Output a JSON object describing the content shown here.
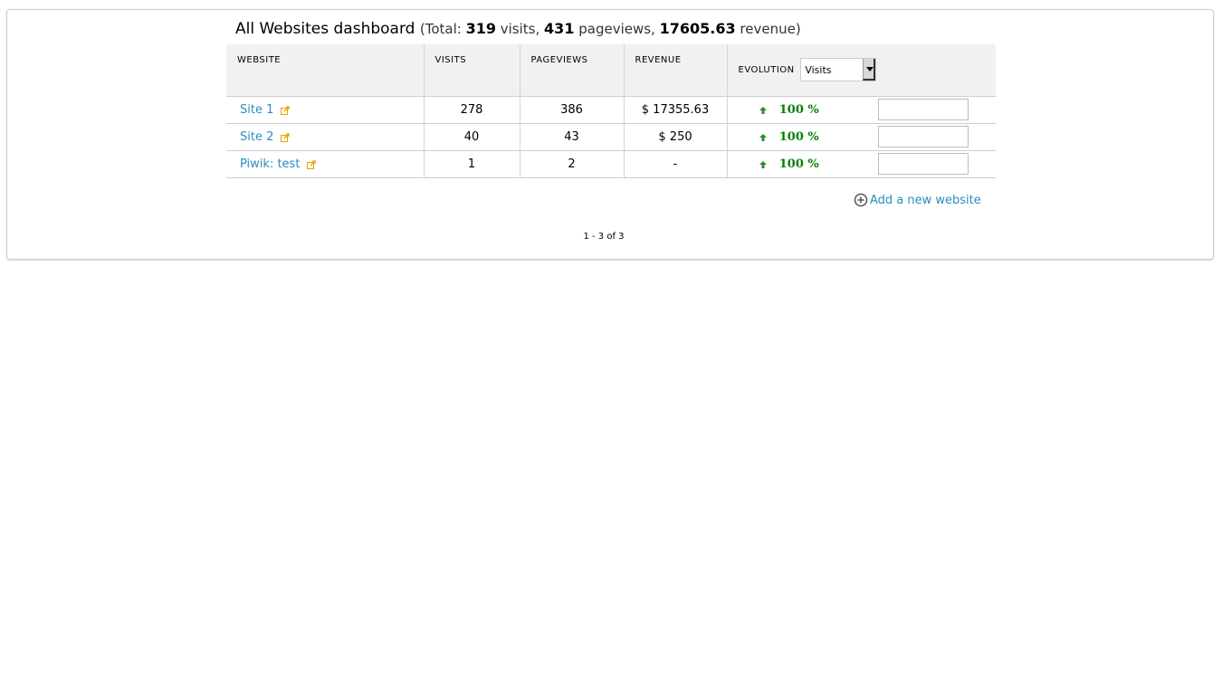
{
  "dashboard": {
    "title": "All Websites dashboard",
    "totals_prefix": "(Total:",
    "total_visits": "319",
    "visits_word": "visits,",
    "total_pageviews": "431",
    "pageviews_word": "pageviews,",
    "total_revenue": "17605.63",
    "revenue_word": "revenue)"
  },
  "table": {
    "headers": {
      "website": "WEBSITE",
      "visits": "VISITS",
      "pageviews": "PAGEVIEWS",
      "revenue": "REVENUE",
      "evolution": "EVOLUTION"
    },
    "evolution_select": {
      "selected": "Visits"
    },
    "rows": [
      {
        "name": "Site 1",
        "visits": "278",
        "pageviews": "386",
        "revenue": "$ 17355.63",
        "evolution": "100 %"
      },
      {
        "name": "Site 2",
        "visits": "40",
        "pageviews": "43",
        "revenue": "$ 250",
        "evolution": "100 %"
      },
      {
        "name": "Piwik: test",
        "visits": "1",
        "pageviews": "2",
        "revenue": "-",
        "evolution": "100 %"
      }
    ]
  },
  "add_website_label": "Add a new website",
  "pagination": "1 - 3 of 3",
  "colors": {
    "link": "#2a8ebd",
    "positive": "#008000",
    "header_bg": "#f1f1f1",
    "external_icon": "#e8a200"
  },
  "icons": {
    "external": "external-link-icon",
    "up": "arrow-up-icon",
    "add": "plus-circle-icon"
  }
}
